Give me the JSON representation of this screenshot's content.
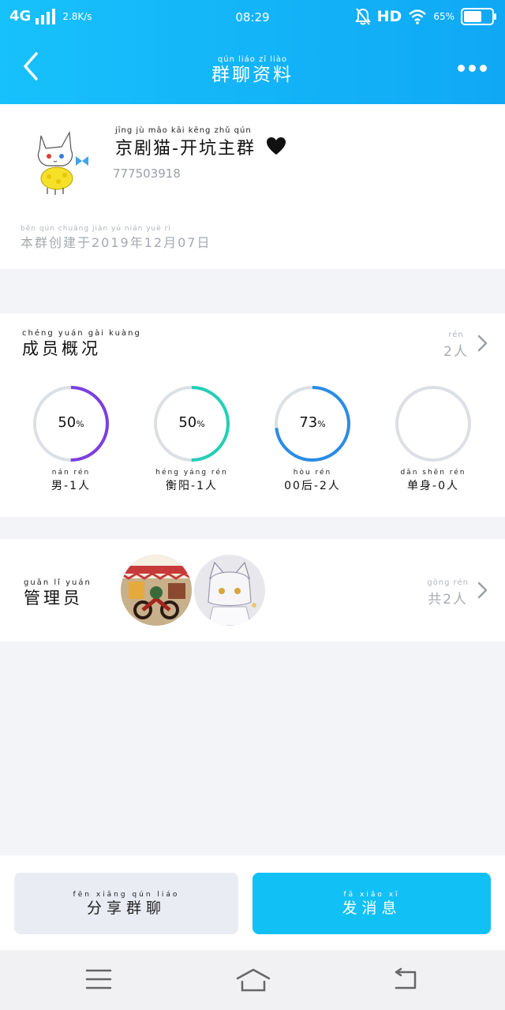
{
  "status_bar": {
    "network": "4G",
    "speed": "2.8K/s",
    "time": "08:29",
    "hd": "HD",
    "battery_pct": "65%",
    "battery_level": 0.65
  },
  "nav": {
    "title": "群聊资料",
    "title_pinyin": "qún liáo zī liào"
  },
  "group": {
    "name": "京剧猫-开坑主群",
    "name_pinyin": "jīng jù māo  kāi kēng zhǔ qún",
    "id": "777503918",
    "created": "本群创建于2019年12月07日",
    "created_pinyin": "běn qún chuàng jiàn yú        nián     yuè     rì"
  },
  "members": {
    "label": "成员概况",
    "label_pinyin": "chéng yuán gài kuàng",
    "count": "2人",
    "count_pinyin": "rén",
    "stats": [
      {
        "value": "50",
        "unit": "%",
        "label": "男-1人",
        "label_pinyin": "nán    rén",
        "fraction": 0.5,
        "color": "#7b3fe0"
      },
      {
        "value": "50",
        "unit": "%",
        "label": "衡阳-1人",
        "label_pinyin": "héng yáng   rén",
        "fraction": 0.5,
        "color": "#23cfb6"
      },
      {
        "value": "73",
        "unit": "%",
        "label": "00后-2人",
        "label_pinyin": "hòu    rén",
        "fraction": 0.73,
        "color": "#2a8ce6"
      },
      {
        "value": "",
        "unit": "",
        "label": "单身-0人",
        "label_pinyin": "dān shēn   rén",
        "fraction": 0,
        "color": "#2a8ce6"
      }
    ]
  },
  "admins": {
    "label": "管理员",
    "label_pinyin": "guǎn lǐ yuán",
    "count": "共2人",
    "count_pinyin": "gòng rén"
  },
  "actions": {
    "share_label": "分享群聊",
    "share_pinyin": "fēn xiǎng qún liáo",
    "send_label": "发消息",
    "send_pinyin": "fā xiāo xī"
  },
  "colors": {
    "header": "#12b4f8",
    "accent_button": "#11c1f6",
    "ring_track": "#dcdfe4"
  }
}
